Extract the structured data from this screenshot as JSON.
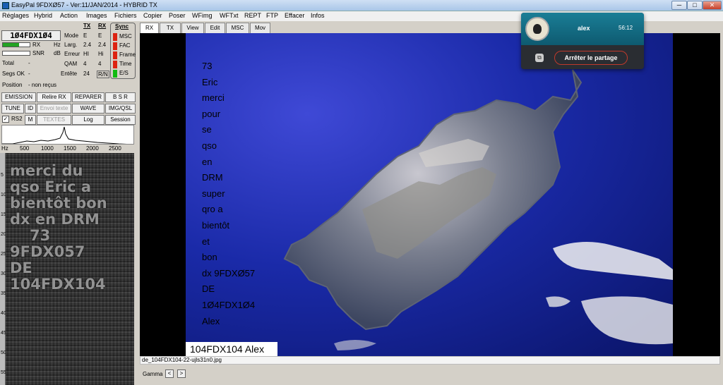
{
  "window": {
    "title": "EasyPal  9FDXØ57 - Ver:11/JAN/2014 - HYBRID TX",
    "minimize": "─",
    "maximize": "□",
    "close": "✕"
  },
  "menu": [
    "Réglages",
    "Hybrid",
    "Action",
    "Images",
    "Fichiers",
    "Copier",
    "Poser",
    "WFimg",
    "WFTxt",
    "REPT",
    "FTP",
    "Effacer",
    "Infos"
  ],
  "status": {
    "callsign": "1Ø4FDX1Ø4",
    "rx_label": "RX",
    "hz_label": "Hz",
    "snr_label": "SNR",
    "db_label": "dB",
    "rx_level": 0.6,
    "total_label": "Total",
    "total_value": "-",
    "segs_label": "Segs OK",
    "segs_value": "-",
    "position_label": "Position",
    "position_value": "- non reçus",
    "mode_labels": [
      "Mode",
      "Larg.",
      "Erreur",
      "QAM",
      "Entête"
    ],
    "tx_header": "TX",
    "rx_header": "RX",
    "tx_values": [
      "E",
      "2.4",
      "HI",
      "4",
      "24"
    ],
    "rx_values": [
      "E",
      "2.4",
      "Hi",
      "4",
      "R/N"
    ],
    "sync_header": "Sync",
    "sync_items": [
      "MSC",
      "FAC",
      "Frame",
      "Time",
      "E/S"
    ]
  },
  "buttons": {
    "emission": "EMISSION",
    "relire": "Relire RX",
    "reparer": "REPARER",
    "bsr": "B S R",
    "tune": "TUNE",
    "id": "ID",
    "envoi": "Envoi texte",
    "wave": "WAVE",
    "imgqsl": "IMG/QSL",
    "rs2": "RS2",
    "m": "M",
    "textes": "TEXTES",
    "log": "Log",
    "session": "Session",
    "check_mark": "✓"
  },
  "spectrum": {
    "axis_label": "Hz",
    "ticks": [
      "500",
      "1000",
      "1500",
      "2000",
      "2500"
    ]
  },
  "waterfall": {
    "text_lines": [
      "merci du",
      "qso Eric a",
      "bientôt bon",
      "dx  en DRM",
      "73",
      "9FDX057",
      "DE",
      "104FDX104"
    ],
    "ruler_marks": [
      "5",
      "10",
      "15",
      "20",
      "25",
      "30",
      "35",
      "40",
      "45",
      "50",
      "55"
    ]
  },
  "tabs": [
    "RX",
    "TX",
    "View",
    "Edit",
    "MSC",
    "Mov"
  ],
  "image": {
    "caption_lines": [
      "73",
      "Eric",
      "merci",
      "pour",
      "se",
      "qso",
      "en",
      "DRM",
      "super",
      "qro a",
      "bientôt",
      "et",
      "bon",
      "dx 9FDXØ57",
      "DE",
      "1Ø4FDX1Ø4",
      "Alex"
    ],
    "name_label": "104FDX104 Alex",
    "filename": "de_104FDX104-22-ujls31n0.jpg"
  },
  "share_popup": {
    "user": "alex",
    "time": "56:12",
    "stop_label": "Arrêter le partage",
    "share_icon": "⧉"
  },
  "gamma": {
    "label": "Gamma",
    "dec": "<",
    "inc": ">"
  }
}
